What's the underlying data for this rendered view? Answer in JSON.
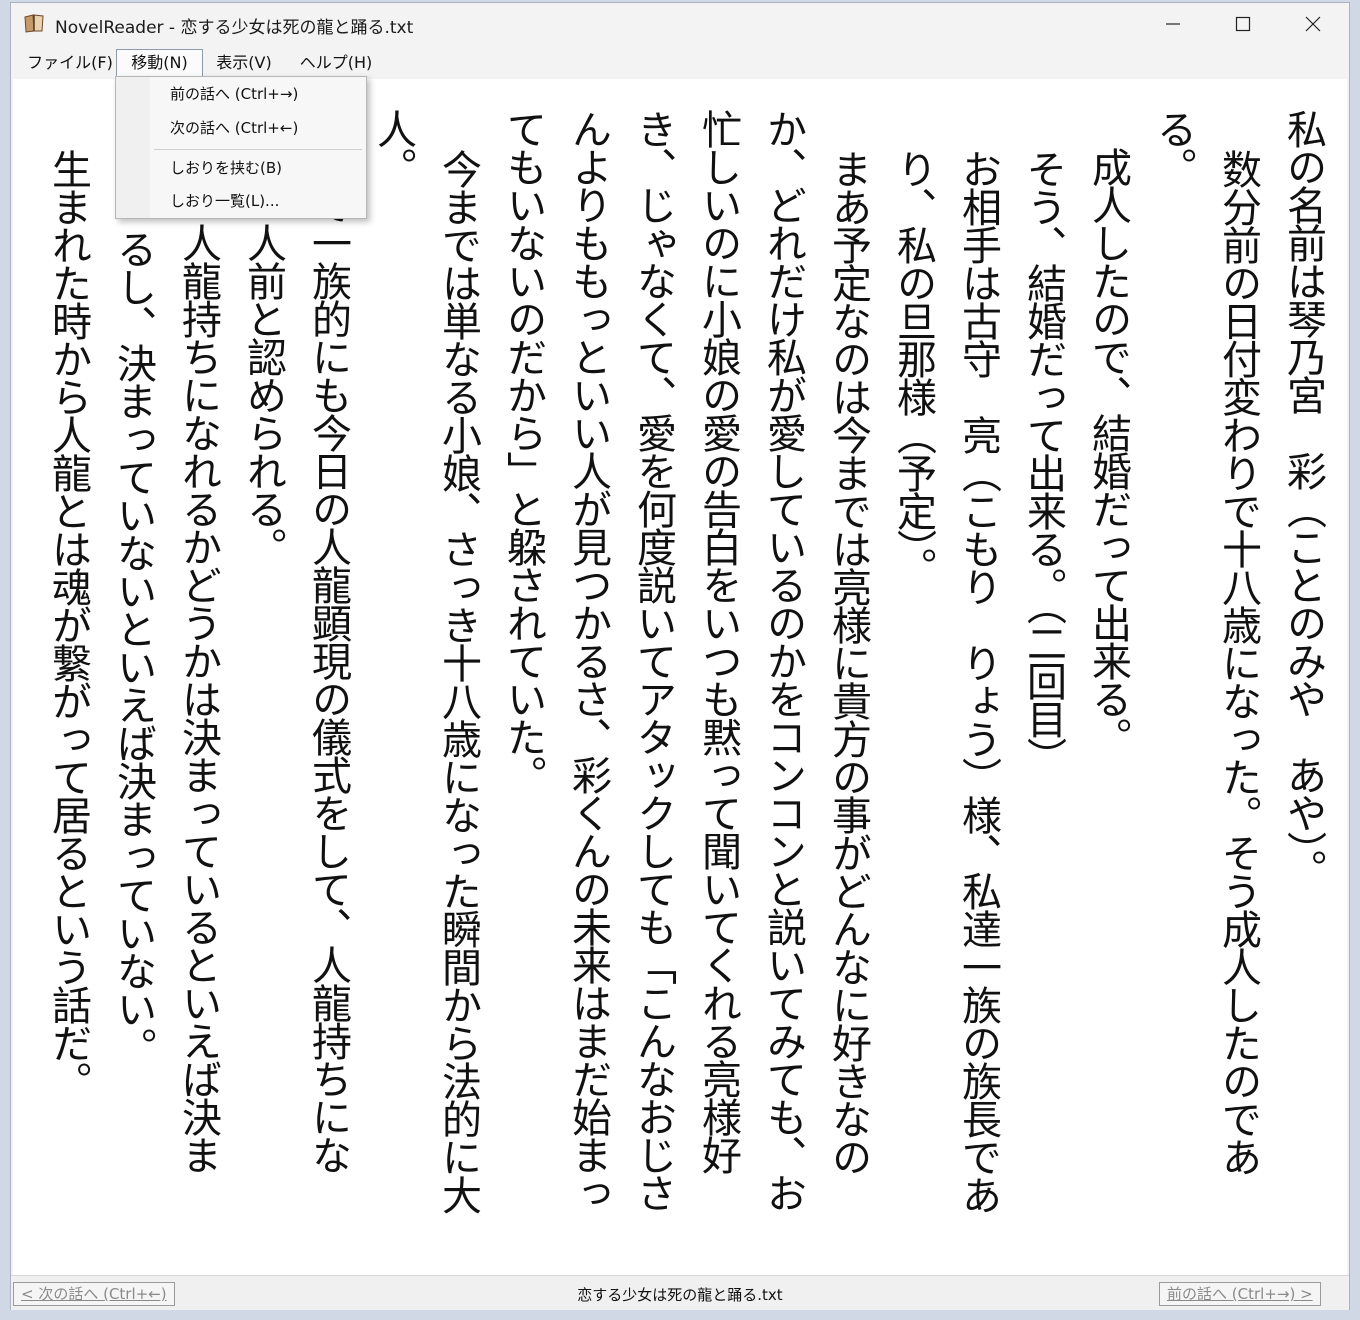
{
  "window": {
    "title": "NovelReader - 恋する少女は死の龍と踊る.txt",
    "icon": "book-icon"
  },
  "menu": {
    "items": [
      {
        "label": "ファイル(F)"
      },
      {
        "label": "移動(N)"
      },
      {
        "label": "表示(V)"
      },
      {
        "label": "ヘルプ(H)"
      }
    ],
    "dropdown": {
      "prev": "前の話へ (Ctrl+→)",
      "next": "次の話へ (Ctrl+←)",
      "bookmark_add": "しおりを挟む(B)",
      "bookmark_list": "しおり一覧(L)..."
    }
  },
  "content": {
    "columns": [
      "私の名前は琴乃宮　彩（ことのみや　あや）。",
      "数分前の日付変わりで十八歳になった。そう成人したのであ",
      "る。",
      "　成人したので、結婚だって出来る。",
      "そう、結婚だって出来る。（二回目）",
      "お相手は古守　亮（こもり　りょう）様、私達一族の族長であ",
      "り、私の旦那様（予定）。",
      "まあ予定なのは今までは亮様に貴方の事がどんなに好きなの",
      "か、どれだけ私が愛しているのかをコンコンと説いてみても、お",
      "忙しいのに小娘の愛の告白をいつも黙って聞いてくれる亮様好",
      "き、じゃなくて、愛を何度説いてアタックしても「こんなおじさ",
      "んよりももっといい人が見つかるさ、彩くんの未来はまだ始まっ",
      "てもいないのだから」と躱されていた。",
      "今までは単なる小娘、さっき十八歳になった瞬間から法的に大",
      "人。",
      "　　て一族的にも今日の人龍顕現の儀式をして、人龍持ちにな",
      "　　一人前と認められる。",
      "　　、人龍持ちになれるかどうかは決まっているといえば決ま",
      "るし、決まっていないといえば決まっていない。",
      "生まれた時から人龍とは魂が繋がって居るという話だ。"
    ]
  },
  "status": {
    "next_button": "< 次の話へ (Ctrl+←)",
    "file_name": "恋する少女は死の龍と踊る.txt",
    "prev_button": "前の話へ (Ctrl+→) >"
  }
}
